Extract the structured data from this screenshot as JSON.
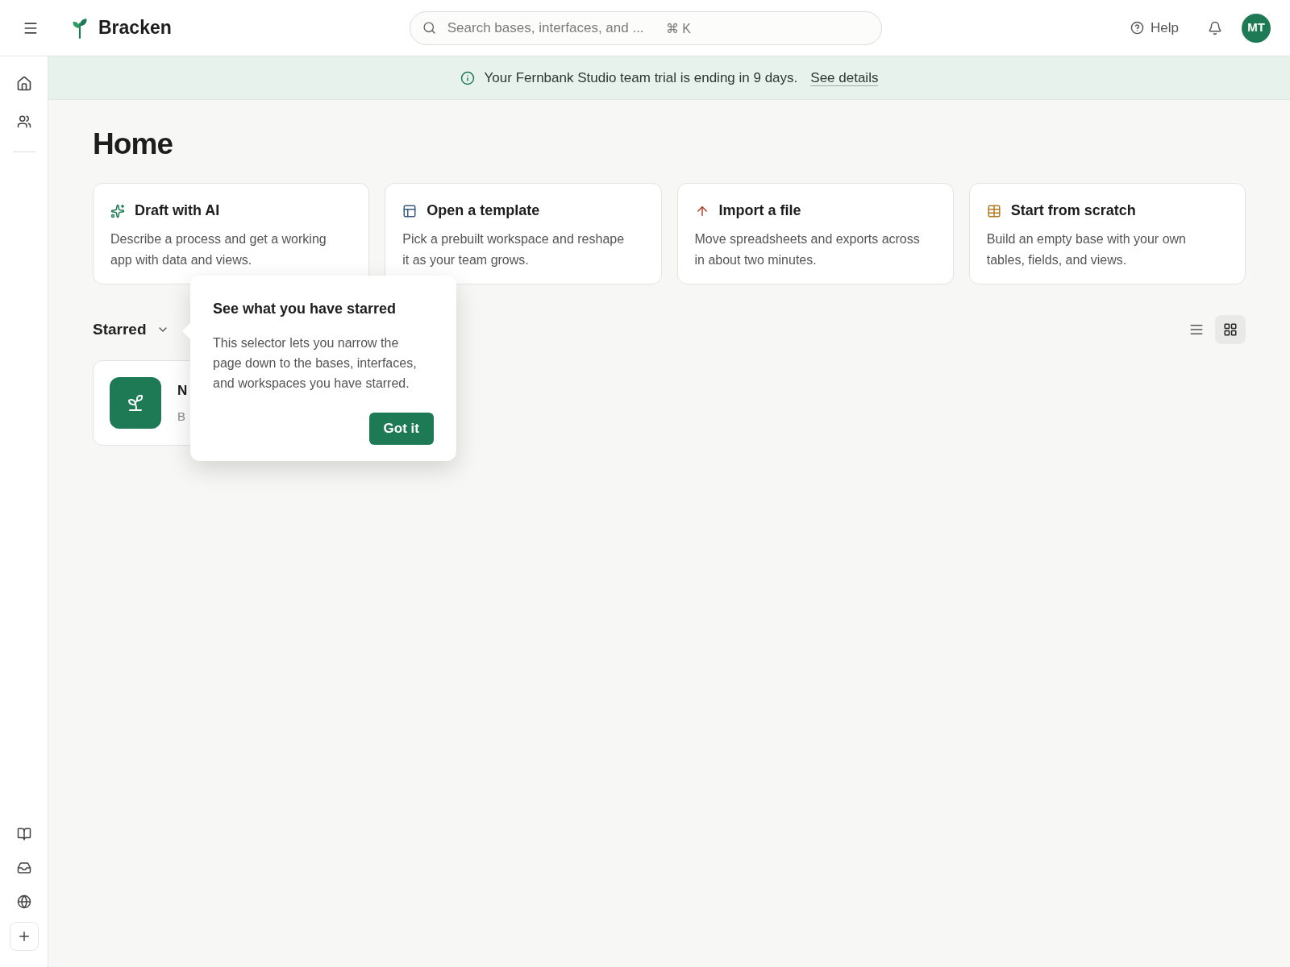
{
  "header": {
    "brand": "Bracken",
    "search": {
      "placeholder": "Search bases, interfaces, and ...",
      "shortcut": "⌘ K"
    },
    "help": "Help",
    "avatar": "MT"
  },
  "banner": {
    "text": "Your Fernbank Studio team trial is ending in 9 days.",
    "link": "See details"
  },
  "page": {
    "title": "Home"
  },
  "actions": [
    {
      "kind": "ai",
      "title": "Draft with AI",
      "description": "Describe a process and get a working app with data and views."
    },
    {
      "kind": "template",
      "title": "Open a template",
      "description": "Pick a prebuilt workspace and reshape it as your team grows."
    },
    {
      "kind": "import",
      "title": "Import a file",
      "description": "Move spreadsheets and exports across in about two minutes."
    },
    {
      "kind": "scratch",
      "title": "Start from scratch",
      "description": "Build an empty base with your own tables, fields, and views."
    }
  ],
  "filter": {
    "label": "Starred"
  },
  "views": [
    {
      "kind": "list",
      "selected": false
    },
    {
      "kind": "grid",
      "selected": true
    }
  ],
  "bases": [
    {
      "name": "N",
      "subtitle": "B"
    }
  ],
  "popover": {
    "title": "See what you have starred",
    "body": "This selector lets you narrow the page down to the bases, interfaces, and workspaces you have starred.",
    "button": "Got it"
  }
}
